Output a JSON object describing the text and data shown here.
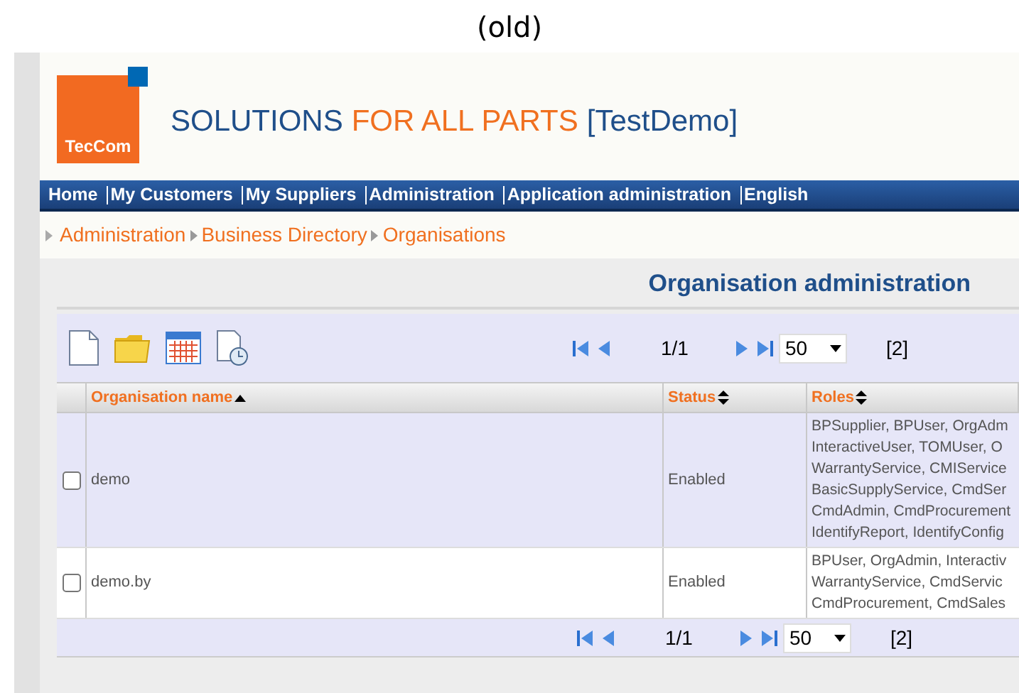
{
  "caption": "(old)",
  "header": {
    "logo_text": "TecCom",
    "title_parts": [
      {
        "text": "SOLUTIONS",
        "kind": "blue"
      },
      {
        "text": "FOR ALL PARTS",
        "kind": "orange"
      },
      {
        "text": "[TestDemo]",
        "kind": "blue"
      }
    ]
  },
  "nav": [
    "Home",
    "My Customers",
    "My Suppliers",
    "Administration",
    "Application administration",
    "English"
  ],
  "breadcrumb": [
    "Administration",
    "Business Directory",
    "Organisations"
  ],
  "page_title": "Organisation administration",
  "pager": {
    "page": "1/1",
    "page_size": "50",
    "count": "[2]"
  },
  "table": {
    "columns": [
      {
        "label": "Organisation name",
        "sorted": true
      },
      {
        "label": "Status",
        "sorted": false
      },
      {
        "label": "Roles",
        "sorted": false
      }
    ],
    "rows": [
      {
        "checked": false,
        "name": "demo",
        "status": "Enabled",
        "roles": [
          "BPSupplier, BPUser, OrgAdm",
          "InteractiveUser, TOMUser, O",
          "WarrantyService, CMIService",
          "BasicSupplyService, CmdSer",
          "CmdAdmin, CmdProcurement",
          "IdentifyReport, IdentifyConfig"
        ]
      },
      {
        "checked": false,
        "name": "demo.by",
        "status": "Enabled",
        "roles": [
          "BPUser, OrgAdmin, Interactiv",
          "WarrantyService, CmdServic",
          "CmdProcurement, CmdSales"
        ]
      }
    ]
  },
  "footer_pager": {
    "page": "1/1",
    "page_size": "50",
    "count": "[2]"
  }
}
